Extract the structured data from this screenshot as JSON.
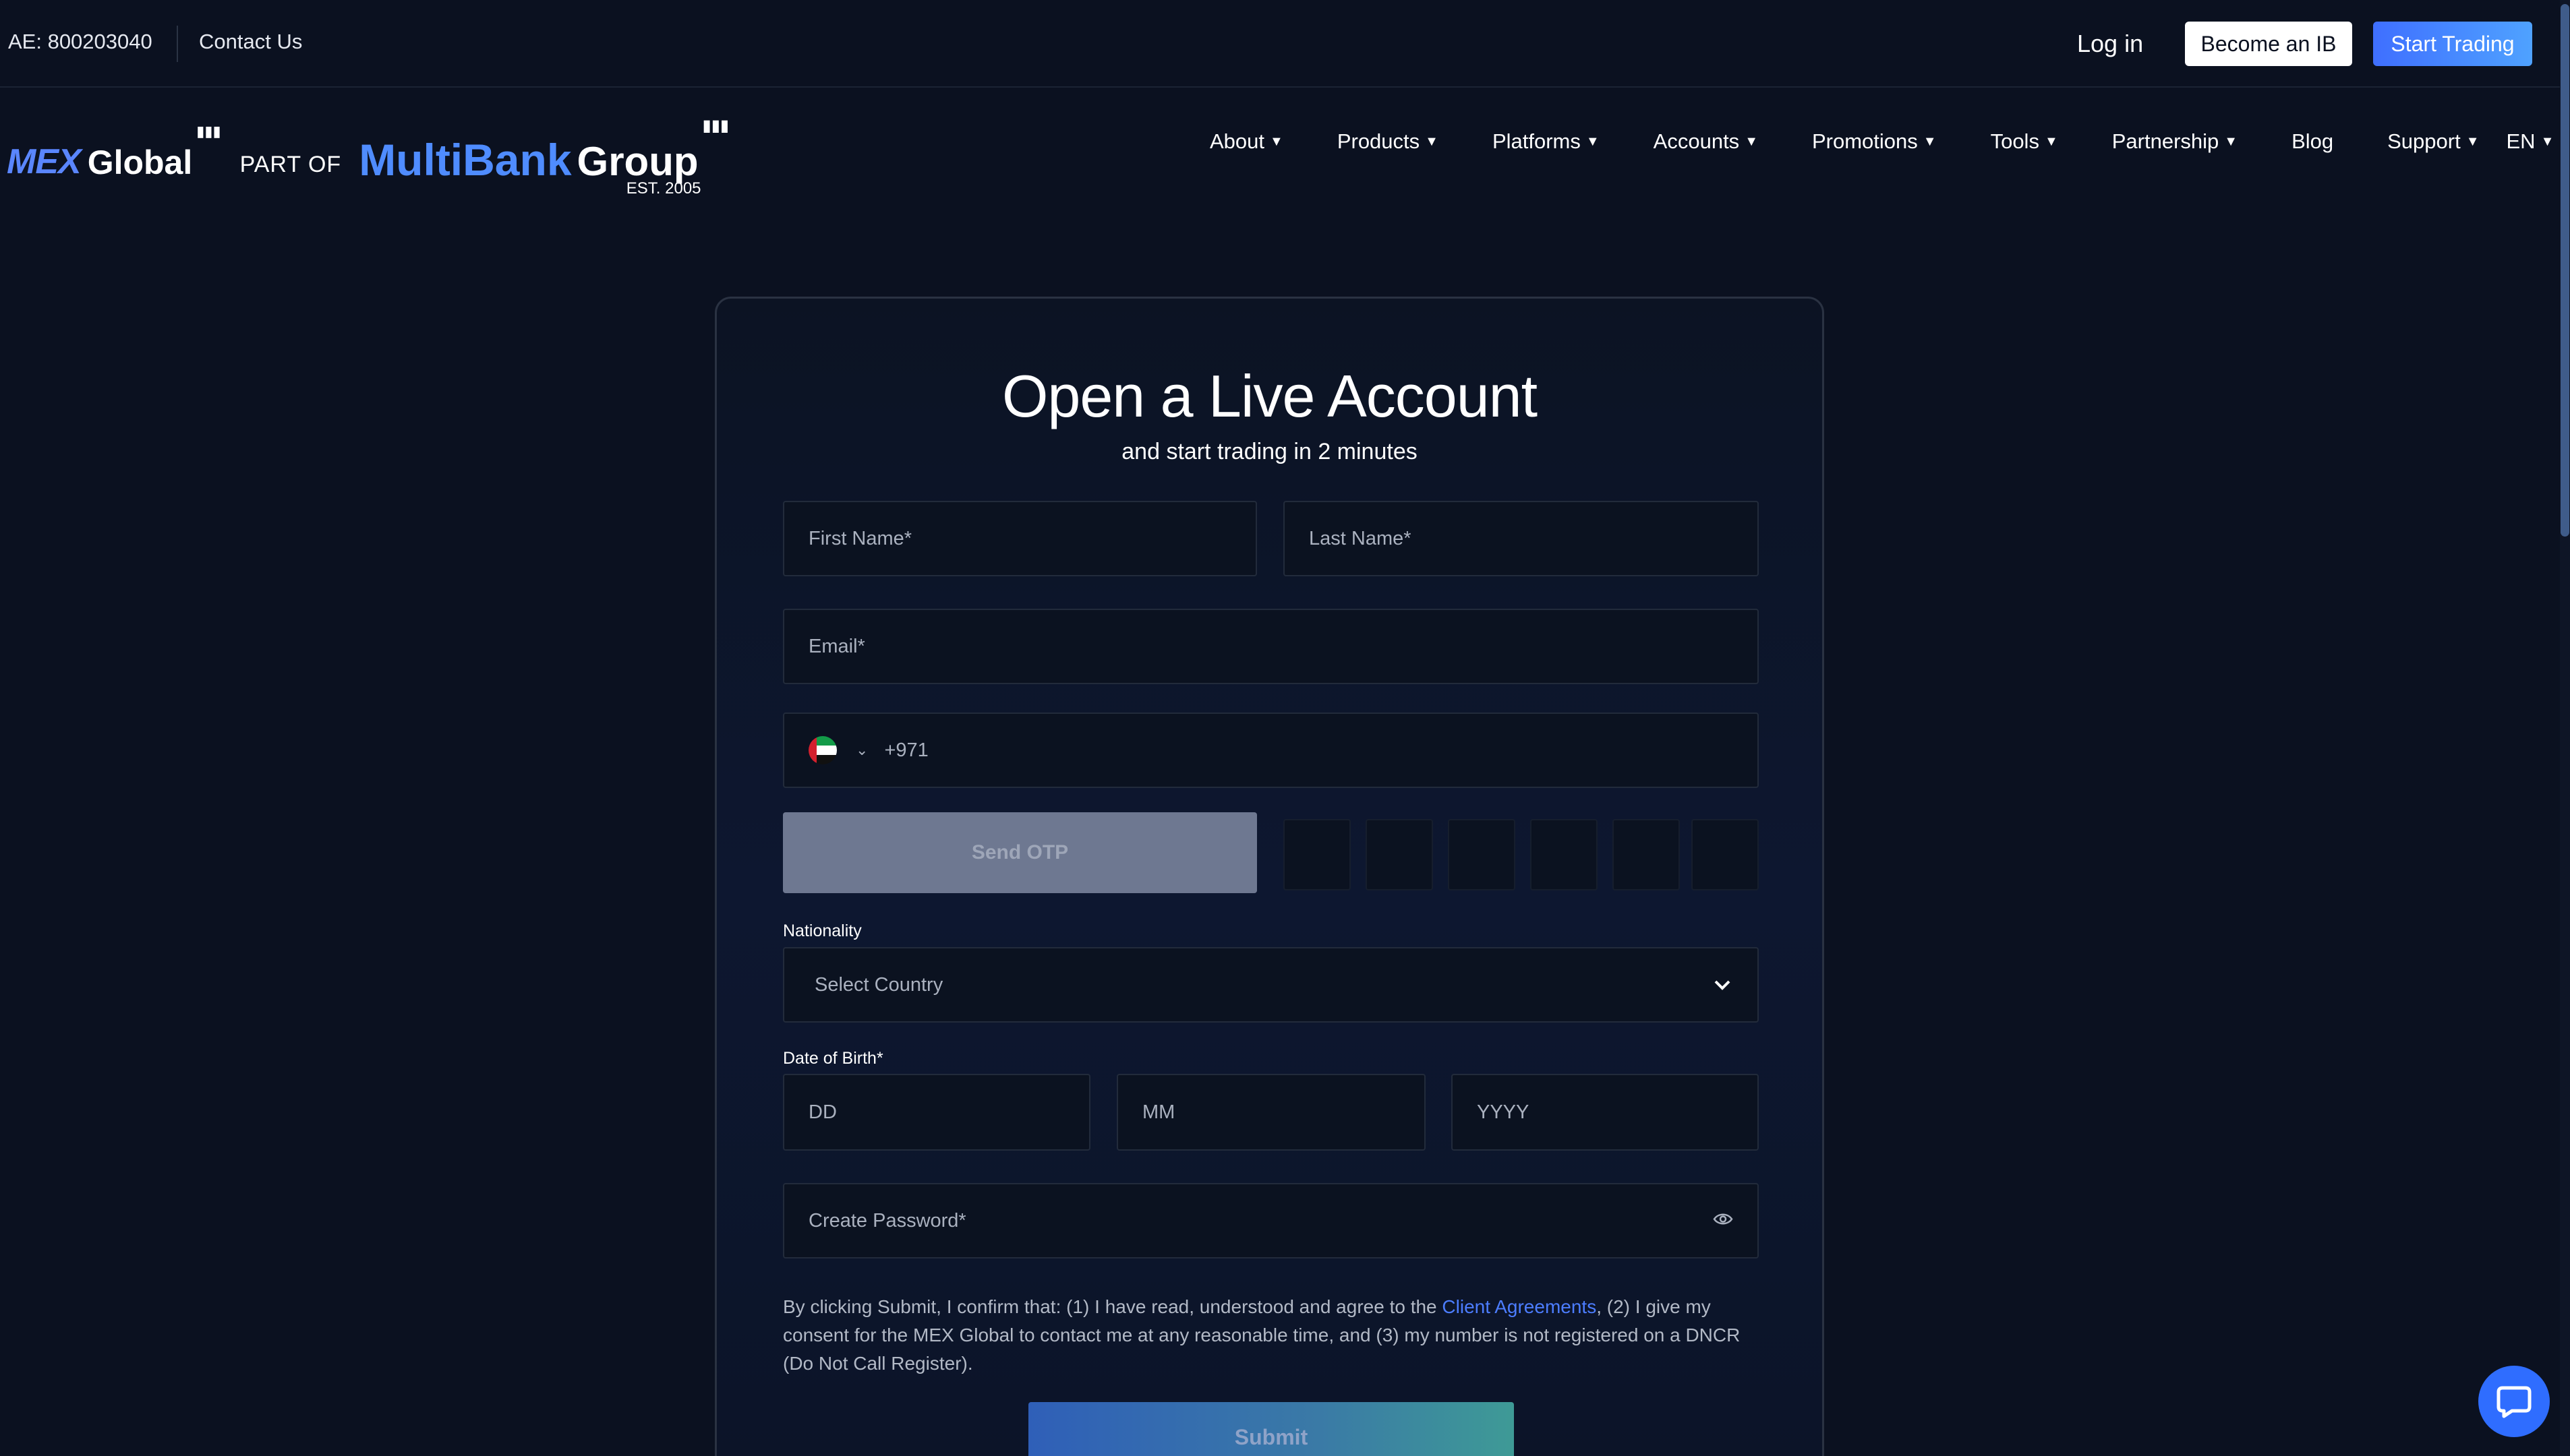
{
  "topbar": {
    "phone": "AE: 800203040",
    "contact": "Contact Us",
    "login": "Log in",
    "become_ib": "Become an IB",
    "start_trading": "Start Trading"
  },
  "logo": {
    "mex": "MEX",
    "global": "Global",
    "part_of": "PART OF",
    "multibank": "MultiBank",
    "group": "Group",
    "est": "EST. 2005"
  },
  "nav": {
    "items": [
      {
        "label": "About",
        "dropdown": true
      },
      {
        "label": "Products",
        "dropdown": true
      },
      {
        "label": "Platforms",
        "dropdown": true
      },
      {
        "label": "Accounts",
        "dropdown": true
      },
      {
        "label": "Promotions",
        "dropdown": true
      },
      {
        "label": "Tools",
        "dropdown": true
      },
      {
        "label": "Partnership",
        "dropdown": true
      },
      {
        "label": "Blog",
        "dropdown": false
      },
      {
        "label": "Support",
        "dropdown": true
      },
      {
        "label": "EN",
        "dropdown": true
      }
    ]
  },
  "form": {
    "title": "Open a Live Account",
    "subtitle": "and start trading in 2 minutes",
    "first_name_placeholder": "First Name*",
    "last_name_placeholder": "Last Name*",
    "email_placeholder": "Email*",
    "phone_code": "+971",
    "phone_flag": "uae-flag-icon",
    "send_otp": "Send OTP",
    "otp_digits": [
      "",
      "",
      "",
      "",
      "",
      ""
    ],
    "nationality_label": "Nationality",
    "nationality_placeholder": "Select Country",
    "dob_label": "Date of Birth*",
    "dob_day": "DD",
    "dob_month": "MM",
    "dob_year": "YYYY",
    "password_placeholder": "Create Password*",
    "consent_before": "By clicking Submit, I confirm that: (1) I have read, understood and agree to the ",
    "consent_link": "Client Agreements",
    "consent_after": ", (2) I give my consent for the MEX Global to contact me at any reasonable time, and (3) my number is not registered on a DNCR (Do Not Call Register).",
    "submit": "Submit"
  },
  "colors": {
    "background": "#0b1120",
    "accent": "#4c7dff",
    "otp_button": "#6e7891"
  }
}
